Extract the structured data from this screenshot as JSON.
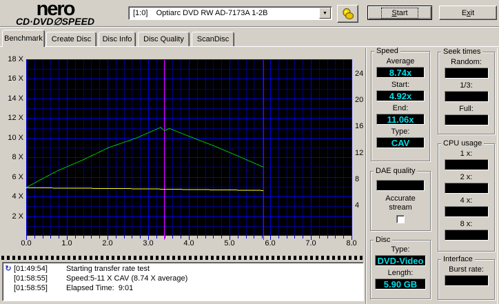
{
  "header": {
    "logo": {
      "line1": "nero",
      "line2": "CD·DVD∅SPEED"
    },
    "drive_select": {
      "value": "[1:0]    Optiarc DVD RW AD-7173A 1-2B"
    },
    "start_button": {
      "pre": "",
      "key": "S",
      "post": "tart"
    },
    "exit_button": {
      "pre": "E",
      "key": "x",
      "post": "it"
    }
  },
  "icons": {
    "dropdown": "▼",
    "log_busy": "↻"
  },
  "tabs": [
    {
      "label": "Benchmark",
      "active": true
    },
    {
      "label": "Create Disc",
      "active": false
    },
    {
      "label": "Disc Info",
      "active": false
    },
    {
      "label": "Disc Quality",
      "active": false
    },
    {
      "label": "ScanDisc",
      "active": false
    }
  ],
  "chart_data": {
    "type": "line",
    "title": "",
    "x_axis": {
      "min": 0,
      "max": 8,
      "minor_step": 0.2,
      "major_step": 1,
      "tick_labels": [
        "0.0",
        "1.0",
        "2.0",
        "3.0",
        "4.0",
        "5.0",
        "6.0",
        "7.0",
        "8.0"
      ],
      "tick_values": [
        0,
        1,
        2,
        3,
        4,
        5,
        6,
        7,
        8
      ]
    },
    "y_axis_left": {
      "min": 0,
      "max": 18,
      "minor_step": 1,
      "major_step": 2,
      "tick_labels": [
        "18 X",
        "16 X",
        "14 X",
        "12 X",
        "10 X",
        "8 X",
        "6 X",
        "4 X",
        "2 X"
      ],
      "tick_values": [
        18,
        16,
        14,
        12,
        10,
        8,
        6,
        4,
        2
      ]
    },
    "y_axis_right": {
      "min": -0.6,
      "max": 26.2,
      "tick_labels": [
        "24",
        "20",
        "16",
        "12",
        "8",
        "4"
      ],
      "tick_values": [
        24,
        20,
        16,
        12,
        8,
        4
      ]
    },
    "series": [
      {
        "name": "read-speed",
        "color": "#00c400",
        "points": [
          [
            0,
            4.92
          ],
          [
            0.3,
            5.6
          ],
          [
            0.76,
            6.6
          ],
          [
            1.4,
            7.75
          ],
          [
            2.03,
            9.0
          ],
          [
            2.7,
            9.95
          ],
          [
            3.31,
            11.06
          ],
          [
            3.4,
            10.7
          ],
          [
            3.52,
            10.95
          ],
          [
            4.0,
            10.15
          ],
          [
            4.6,
            9.2
          ],
          [
            5.2,
            8.15
          ],
          [
            5.83,
            7.0
          ]
        ]
      },
      {
        "name": "rotation-speed",
        "color": "#ffff28",
        "points": [
          [
            0,
            4.9
          ],
          [
            1,
            4.85
          ],
          [
            2,
            4.82
          ],
          [
            3,
            4.78
          ],
          [
            4,
            4.72
          ],
          [
            5,
            4.67
          ],
          [
            5.83,
            4.62
          ]
        ]
      }
    ],
    "markers": [
      {
        "name": "layer-break",
        "x": 3.39,
        "color": "#ff00ff"
      },
      {
        "name": "end-of-disc",
        "x": 5.83,
        "color": "#e00000"
      }
    ],
    "grid": true,
    "background": "#000000",
    "grid_minor_color": "#00008c",
    "grid_major_color": "#0000e8",
    "frame_color": "#0000e8"
  },
  "panels": {
    "speed": {
      "title": "Speed",
      "fields": [
        {
          "label": "Average",
          "value": "8.74x"
        },
        {
          "label": "Start:",
          "value": "4.92x"
        },
        {
          "label": "End:",
          "value": "11.06x"
        },
        {
          "label": "Type:",
          "value": "CAV"
        }
      ]
    },
    "seek_times": {
      "title": "Seek times",
      "fields": [
        {
          "label": "Random:",
          "value": ""
        },
        {
          "label": "1/3:",
          "value": ""
        },
        {
          "label": "Full:",
          "value": ""
        }
      ]
    },
    "cpu_usage": {
      "title": "CPU usage",
      "fields": [
        {
          "label": "1 x:",
          "value": ""
        },
        {
          "label": "2 x:",
          "value": ""
        },
        {
          "label": "4 x:",
          "value": ""
        },
        {
          "label": "8 x:",
          "value": ""
        }
      ]
    },
    "dae_quality": {
      "title": "DAE quality",
      "value": "",
      "accurate_stream_label": "Accurate stream",
      "checkbox_checked": false
    },
    "disc": {
      "title": "Disc",
      "fields": [
        {
          "label": "Type:",
          "value": "DVD-Video"
        },
        {
          "label": "Length:",
          "value": "5.90 GB"
        }
      ]
    },
    "interface": {
      "title": "Interface",
      "fields": [
        {
          "label": "Burst rate:",
          "value": ""
        }
      ]
    }
  },
  "log": {
    "entries": [
      {
        "time": "[01:49:54]",
        "text": "Starting transfer rate test",
        "busy_icon": true
      },
      {
        "time": "[01:58:55]",
        "text": "Speed:5-11 X CAV (8.74 X average)",
        "busy_icon": false
      },
      {
        "time": "[01:58:55]",
        "text": "Elapsed Time:  9:01",
        "busy_icon": false
      }
    ]
  },
  "colors": {
    "window_background": "#d4d0c8",
    "value_text": "#00dce8",
    "value_box_background": "#000000",
    "log_icon": "#2b3fbf"
  }
}
